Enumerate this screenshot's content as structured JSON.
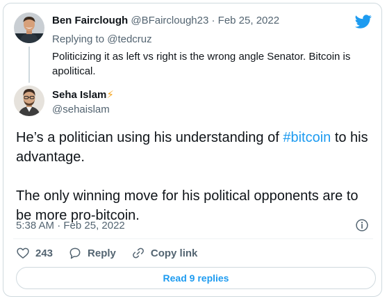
{
  "parent_tweet": {
    "name": "Ben Fairclough",
    "handle": "@BFairclough23",
    "separator": "·",
    "date": "Feb 25, 2022",
    "replying_prefix": "Replying to",
    "replying_to": "@tedcruz",
    "text": "Politicizing it as left vs right is the wrong angle Senator.  Bitcoin is apolitical."
  },
  "main_tweet": {
    "name": "Seha Islam",
    "name_emoji": "⚡",
    "handle": "@sehaislam",
    "text_line1_before": "He’s a politician using his understanding of ",
    "hashtag": "#bitcoin",
    "text_line1_after": " to his advantage.",
    "text_paragraph2": "The only winning move for his political opponents are to be more pro-bitcoin.",
    "timestamp": "5:38 AM · Feb 25, 2022"
  },
  "actions": {
    "like_count": "243",
    "reply_label": "Reply",
    "copy_link_label": "Copy link"
  },
  "read_replies_label": "Read 9 replies",
  "icons": {
    "brand": "twitter-bird-icon",
    "info": "info-icon",
    "like": "heart-icon",
    "reply": "reply-bubble-icon",
    "copy_link": "link-icon"
  },
  "colors": {
    "accent": "#1d9bf0",
    "secondary_text": "#536471",
    "primary_text": "#0f1419",
    "border": "#cfd9de",
    "bolt": "#f5a623"
  }
}
